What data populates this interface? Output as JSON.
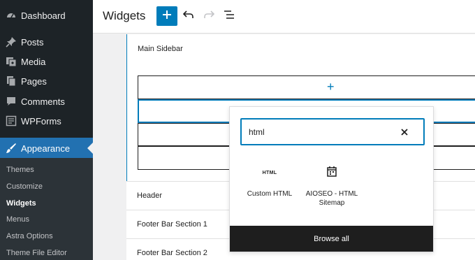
{
  "colors": {
    "sidebar_bg": "#1d2327",
    "accent": "#2271b1",
    "editor_blue": "#007cba"
  },
  "sidebar": {
    "items": [
      {
        "label": "Dashboard",
        "icon": "dashboard-icon"
      },
      {
        "label": "Posts",
        "icon": "pin-icon"
      },
      {
        "label": "Media",
        "icon": "media-icon"
      },
      {
        "label": "Pages",
        "icon": "pages-icon"
      },
      {
        "label": "Comments",
        "icon": "comment-icon"
      },
      {
        "label": "WPForms",
        "icon": "forms-icon"
      },
      {
        "label": "Appearance",
        "icon": "brush-icon",
        "active": true
      }
    ],
    "submenu": [
      {
        "label": "Themes"
      },
      {
        "label": "Customize"
      },
      {
        "label": "Widgets",
        "current": true
      },
      {
        "label": "Menus"
      },
      {
        "label": "Astra Options"
      },
      {
        "label": "Theme File Editor"
      }
    ]
  },
  "topbar": {
    "title": "Widgets",
    "add_icon": "plus-icon",
    "undo_icon": "undo-icon",
    "redo_icon": "redo-icon",
    "list_icon": "list-view-icon"
  },
  "canvas": {
    "main_sidebar_title": "Main Sidebar",
    "areas": [
      "Header",
      "Footer Bar Section 1",
      "Footer Bar Section 2"
    ]
  },
  "inserter": {
    "search_value": "html",
    "results": [
      {
        "label": "Custom HTML",
        "icon_text": "HTML"
      },
      {
        "label": "AIOSEO - HTML Sitemap",
        "icon": "calendar-icon"
      }
    ],
    "browse_all": "Browse all"
  }
}
